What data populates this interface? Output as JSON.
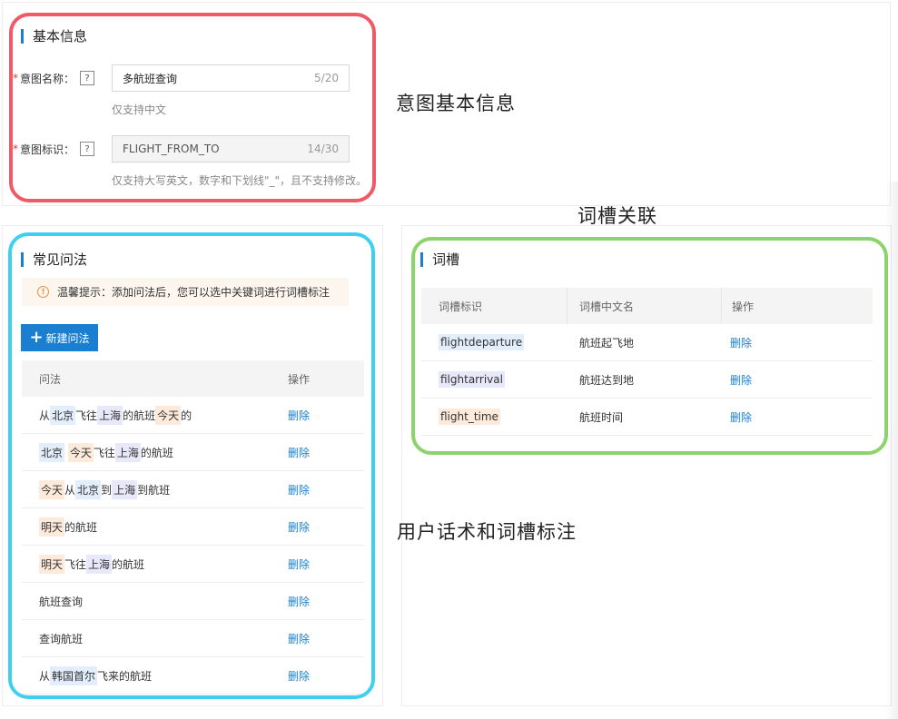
{
  "basic": {
    "title": "基本信息",
    "intent_name_label": "意图名称：",
    "intent_name_value": "多航班查询",
    "intent_name_count": "5/20",
    "intent_name_hint": "仅支持中文",
    "intent_id_label": "意图标识：",
    "intent_id_value": "FLIGHT_FROM_TO",
    "intent_id_count": "14/30",
    "intent_id_hint": "仅支持大写英文，数字和下划线\"_\"，且不支持修改。",
    "required_mark": "*",
    "help_mark": "?"
  },
  "annotations": {
    "basic": "意图基本信息",
    "slots": "词槽关联",
    "utterances": "用户话术和词槽标注"
  },
  "utterances": {
    "title": "常见问法",
    "tip_icon": "!",
    "tip": "温馨提示：添加问法后，您可以选中关键词进行词槽标注",
    "new_button_icon": "+",
    "new_button": "新建问法",
    "col_query": "问法",
    "col_action": "操作",
    "delete_label": "删除",
    "rows": [
      {
        "segments": [
          {
            "t": "从"
          },
          {
            "t": "北京",
            "c": "blue"
          },
          {
            "t": "飞往"
          },
          {
            "t": "上海",
            "c": "lilac"
          },
          {
            "t": "的航班"
          },
          {
            "t": "今天",
            "c": "orange"
          },
          {
            "t": "的"
          }
        ]
      },
      {
        "segments": [
          {
            "t": "北京",
            "c": "blue"
          },
          {
            "t": " "
          },
          {
            "t": "今天",
            "c": "orange"
          },
          {
            "t": "飞往"
          },
          {
            "t": "上海",
            "c": "lilac"
          },
          {
            "t": "的航班"
          }
        ]
      },
      {
        "segments": [
          {
            "t": "今天",
            "c": "orange"
          },
          {
            "t": "从"
          },
          {
            "t": "北京",
            "c": "blue"
          },
          {
            "t": "到"
          },
          {
            "t": "上海",
            "c": "lilac"
          },
          {
            "t": "到航班"
          }
        ]
      },
      {
        "segments": [
          {
            "t": "明天",
            "c": "orange"
          },
          {
            "t": "的航班"
          }
        ]
      },
      {
        "segments": [
          {
            "t": "明天",
            "c": "orange"
          },
          {
            "t": "飞往"
          },
          {
            "t": "上海",
            "c": "lilac"
          },
          {
            "t": "的航班"
          }
        ]
      },
      {
        "segments": [
          {
            "t": "航班查询"
          }
        ]
      },
      {
        "segments": [
          {
            "t": "查询航班"
          }
        ]
      },
      {
        "segments": [
          {
            "t": "从"
          },
          {
            "t": "韩国首尔",
            "c": "blue"
          },
          {
            "t": "飞来的航班"
          }
        ]
      }
    ]
  },
  "slots": {
    "title": "词槽",
    "col_id": "词槽标识",
    "col_name": "词槽中文名",
    "col_action": "操作",
    "delete_label": "删除",
    "rows": [
      {
        "id": "flightdeparture",
        "name": "航班起飞地",
        "c": "blue"
      },
      {
        "id": "filghtarrival",
        "name": "航班达到地",
        "c": "lilac"
      },
      {
        "id": "flight_time",
        "name": "航班时间",
        "c": "orange"
      }
    ]
  },
  "colors": {
    "accent": "#1a7fd1",
    "highlight_red": "#ef5a66",
    "highlight_cyan": "#3fd0f0",
    "highlight_green": "#8dd36b"
  }
}
